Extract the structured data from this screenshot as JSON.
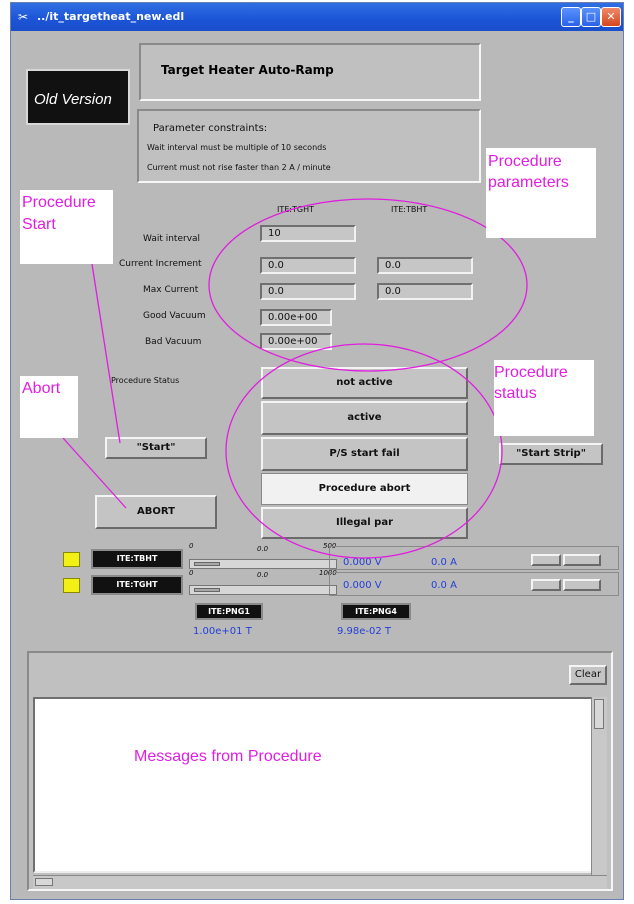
{
  "window": {
    "title": "../it_targetheat_new.edl",
    "minimize": "_",
    "maximize": "□",
    "close": "✕"
  },
  "header": {
    "old_version": "Old Version",
    "title": "Target Heater Auto-Ramp",
    "constraints_title": "Parameter constraints:",
    "constraint_1": "Wait interval must be multiple of 10 seconds",
    "constraint_2": "Current must not rise faster than 2 A / minute"
  },
  "params": {
    "col1": "ITE:TGHT",
    "col2": "ITE:TBHT",
    "wait_label": "Wait interval",
    "wait_value": "10",
    "increment_label": "Current Increment",
    "increment_1": "0.0",
    "increment_2": "0.0",
    "max_label": "Max Current",
    "max_1": "0.0",
    "max_2": "0.0",
    "good_label": "Good Vacuum",
    "good_value": "0.00e+00",
    "bad_label": "Bad Vacuum",
    "bad_value": "0.00e+00",
    "status_label": "Procedure Status"
  },
  "status": {
    "not_active": "not active",
    "active": "active",
    "ps_start_fail": "P/S start fail",
    "procedure_abort": "Procedure abort",
    "illegal_par": "Illegal par"
  },
  "controls": {
    "start": "\"Start\"",
    "abort": "ABORT",
    "start_strip": "\"Start Strip\""
  },
  "supplies": [
    {
      "name": "ITE:TBHT",
      "min": "0",
      "mid": "0.0",
      "max": "500",
      "voltage": "0.000 V",
      "current": "0.0 A"
    },
    {
      "name": "ITE:TGHT",
      "min": "0",
      "mid": "0.0",
      "max": "1000",
      "voltage": "0.000 V",
      "current": "0.0 A"
    }
  ],
  "gauges": [
    {
      "name": "ITE:PNG1",
      "value": "1.00e+01 T"
    },
    {
      "name": "ITE:PNG4",
      "value": "9.98e-02 T"
    }
  ],
  "messages": {
    "clear": "Clear"
  },
  "annotations": {
    "procedure_start_1": "Procedure",
    "procedure_start_2": "Start",
    "abort": "Abort",
    "parameters_1": "Procedure",
    "parameters_2": "parameters",
    "status_1": "Procedure",
    "status_2": "status",
    "messages": "Messages from Procedure"
  },
  "colors": {
    "annotation": "#e01ee0",
    "titlebar": "#1c54d6",
    "indicator": "#f3f016",
    "readback": "#2440d8"
  }
}
